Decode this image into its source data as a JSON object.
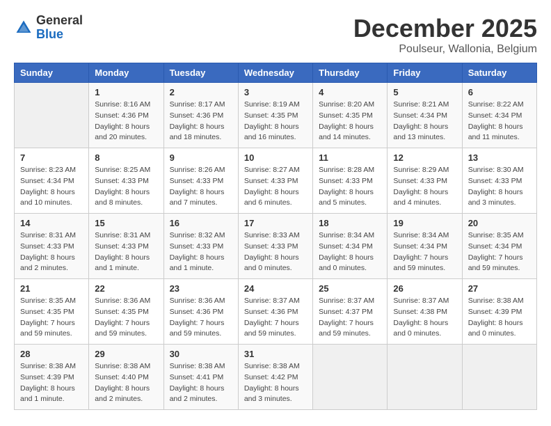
{
  "header": {
    "logo_general": "General",
    "logo_blue": "Blue",
    "month_title": "December 2025",
    "location": "Poulseur, Wallonia, Belgium"
  },
  "weekdays": [
    "Sunday",
    "Monday",
    "Tuesday",
    "Wednesday",
    "Thursday",
    "Friday",
    "Saturday"
  ],
  "weeks": [
    [
      {
        "day": "",
        "sunrise": "",
        "sunset": "",
        "daylight": ""
      },
      {
        "day": "1",
        "sunrise": "Sunrise: 8:16 AM",
        "sunset": "Sunset: 4:36 PM",
        "daylight": "Daylight: 8 hours and 20 minutes."
      },
      {
        "day": "2",
        "sunrise": "Sunrise: 8:17 AM",
        "sunset": "Sunset: 4:36 PM",
        "daylight": "Daylight: 8 hours and 18 minutes."
      },
      {
        "day": "3",
        "sunrise": "Sunrise: 8:19 AM",
        "sunset": "Sunset: 4:35 PM",
        "daylight": "Daylight: 8 hours and 16 minutes."
      },
      {
        "day": "4",
        "sunrise": "Sunrise: 8:20 AM",
        "sunset": "Sunset: 4:35 PM",
        "daylight": "Daylight: 8 hours and 14 minutes."
      },
      {
        "day": "5",
        "sunrise": "Sunrise: 8:21 AM",
        "sunset": "Sunset: 4:34 PM",
        "daylight": "Daylight: 8 hours and 13 minutes."
      },
      {
        "day": "6",
        "sunrise": "Sunrise: 8:22 AM",
        "sunset": "Sunset: 4:34 PM",
        "daylight": "Daylight: 8 hours and 11 minutes."
      }
    ],
    [
      {
        "day": "7",
        "sunrise": "Sunrise: 8:23 AM",
        "sunset": "Sunset: 4:34 PM",
        "daylight": "Daylight: 8 hours and 10 minutes."
      },
      {
        "day": "8",
        "sunrise": "Sunrise: 8:25 AM",
        "sunset": "Sunset: 4:33 PM",
        "daylight": "Daylight: 8 hours and 8 minutes."
      },
      {
        "day": "9",
        "sunrise": "Sunrise: 8:26 AM",
        "sunset": "Sunset: 4:33 PM",
        "daylight": "Daylight: 8 hours and 7 minutes."
      },
      {
        "day": "10",
        "sunrise": "Sunrise: 8:27 AM",
        "sunset": "Sunset: 4:33 PM",
        "daylight": "Daylight: 8 hours and 6 minutes."
      },
      {
        "day": "11",
        "sunrise": "Sunrise: 8:28 AM",
        "sunset": "Sunset: 4:33 PM",
        "daylight": "Daylight: 8 hours and 5 minutes."
      },
      {
        "day": "12",
        "sunrise": "Sunrise: 8:29 AM",
        "sunset": "Sunset: 4:33 PM",
        "daylight": "Daylight: 8 hours and 4 minutes."
      },
      {
        "day": "13",
        "sunrise": "Sunrise: 8:30 AM",
        "sunset": "Sunset: 4:33 PM",
        "daylight": "Daylight: 8 hours and 3 minutes."
      }
    ],
    [
      {
        "day": "14",
        "sunrise": "Sunrise: 8:31 AM",
        "sunset": "Sunset: 4:33 PM",
        "daylight": "Daylight: 8 hours and 2 minutes."
      },
      {
        "day": "15",
        "sunrise": "Sunrise: 8:31 AM",
        "sunset": "Sunset: 4:33 PM",
        "daylight": "Daylight: 8 hours and 1 minute."
      },
      {
        "day": "16",
        "sunrise": "Sunrise: 8:32 AM",
        "sunset": "Sunset: 4:33 PM",
        "daylight": "Daylight: 8 hours and 1 minute."
      },
      {
        "day": "17",
        "sunrise": "Sunrise: 8:33 AM",
        "sunset": "Sunset: 4:33 PM",
        "daylight": "Daylight: 8 hours and 0 minutes."
      },
      {
        "day": "18",
        "sunrise": "Sunrise: 8:34 AM",
        "sunset": "Sunset: 4:34 PM",
        "daylight": "Daylight: 8 hours and 0 minutes."
      },
      {
        "day": "19",
        "sunrise": "Sunrise: 8:34 AM",
        "sunset": "Sunset: 4:34 PM",
        "daylight": "Daylight: 7 hours and 59 minutes."
      },
      {
        "day": "20",
        "sunrise": "Sunrise: 8:35 AM",
        "sunset": "Sunset: 4:34 PM",
        "daylight": "Daylight: 7 hours and 59 minutes."
      }
    ],
    [
      {
        "day": "21",
        "sunrise": "Sunrise: 8:35 AM",
        "sunset": "Sunset: 4:35 PM",
        "daylight": "Daylight: 7 hours and 59 minutes."
      },
      {
        "day": "22",
        "sunrise": "Sunrise: 8:36 AM",
        "sunset": "Sunset: 4:35 PM",
        "daylight": "Daylight: 7 hours and 59 minutes."
      },
      {
        "day": "23",
        "sunrise": "Sunrise: 8:36 AM",
        "sunset": "Sunset: 4:36 PM",
        "daylight": "Daylight: 7 hours and 59 minutes."
      },
      {
        "day": "24",
        "sunrise": "Sunrise: 8:37 AM",
        "sunset": "Sunset: 4:36 PM",
        "daylight": "Daylight: 7 hours and 59 minutes."
      },
      {
        "day": "25",
        "sunrise": "Sunrise: 8:37 AM",
        "sunset": "Sunset: 4:37 PM",
        "daylight": "Daylight: 7 hours and 59 minutes."
      },
      {
        "day": "26",
        "sunrise": "Sunrise: 8:37 AM",
        "sunset": "Sunset: 4:38 PM",
        "daylight": "Daylight: 8 hours and 0 minutes."
      },
      {
        "day": "27",
        "sunrise": "Sunrise: 8:38 AM",
        "sunset": "Sunset: 4:39 PM",
        "daylight": "Daylight: 8 hours and 0 minutes."
      }
    ],
    [
      {
        "day": "28",
        "sunrise": "Sunrise: 8:38 AM",
        "sunset": "Sunset: 4:39 PM",
        "daylight": "Daylight: 8 hours and 1 minute."
      },
      {
        "day": "29",
        "sunrise": "Sunrise: 8:38 AM",
        "sunset": "Sunset: 4:40 PM",
        "daylight": "Daylight: 8 hours and 2 minutes."
      },
      {
        "day": "30",
        "sunrise": "Sunrise: 8:38 AM",
        "sunset": "Sunset: 4:41 PM",
        "daylight": "Daylight: 8 hours and 2 minutes."
      },
      {
        "day": "31",
        "sunrise": "Sunrise: 8:38 AM",
        "sunset": "Sunset: 4:42 PM",
        "daylight": "Daylight: 8 hours and 3 minutes."
      },
      {
        "day": "",
        "sunrise": "",
        "sunset": "",
        "daylight": ""
      },
      {
        "day": "",
        "sunrise": "",
        "sunset": "",
        "daylight": ""
      },
      {
        "day": "",
        "sunrise": "",
        "sunset": "",
        "daylight": ""
      }
    ]
  ]
}
